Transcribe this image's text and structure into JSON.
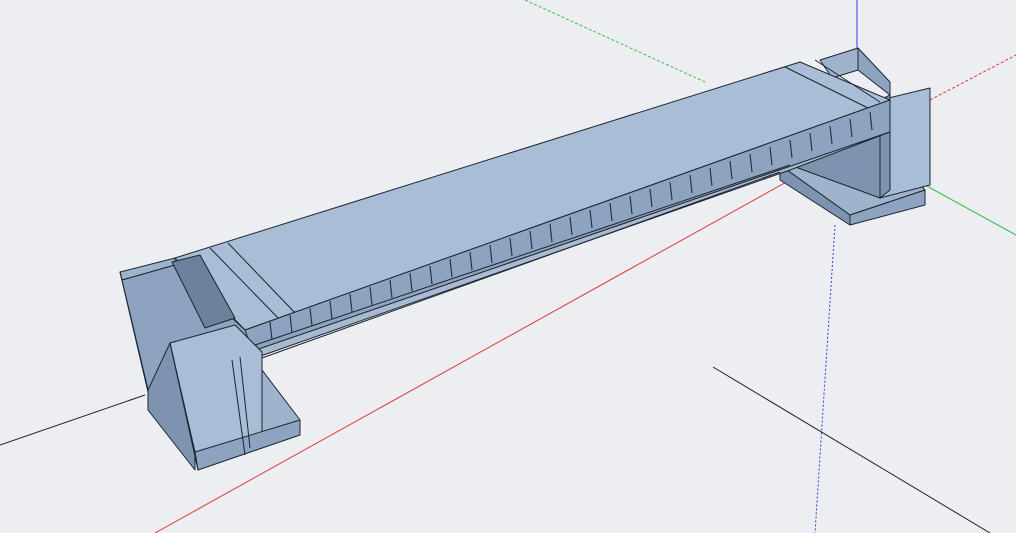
{
  "viewport": {
    "background": "#eceef2",
    "model": "bridge",
    "colors": {
      "model_top": "#a9bdd6",
      "model_side": "#8ea3bf",
      "model_dark": "#6d819c",
      "edge": "#1d2530",
      "axis_red": "#e03a3a",
      "axis_green": "#38c24b",
      "axis_blue": "#3a3ae0",
      "axis_black": "#222222"
    }
  }
}
